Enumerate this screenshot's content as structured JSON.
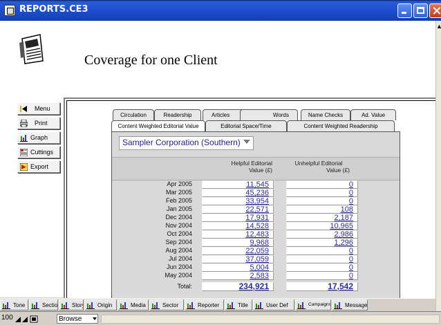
{
  "window": {
    "title": "REPORTS.CE3"
  },
  "page": {
    "title": "Coverage for one Client"
  },
  "nav": {
    "menu": "Menu",
    "print": "Print",
    "graph": "Graph",
    "cuttings": "Cuttings",
    "export": "Export"
  },
  "tabs": {
    "row1": [
      "Circulation",
      "Readership",
      "Articles",
      "Words",
      "Name Checks",
      "Ad. Value"
    ],
    "row2": [
      "Content Weighted Editorial Value",
      "Editorial Space/Time",
      "Content Weighted Readership"
    ]
  },
  "client_select": {
    "value": "Sampler Corporation (Southern)"
  },
  "columns": {
    "helpful_line1": "Helpful Editorial",
    "helpful_line2": "Value (£)",
    "unhelpful_line1": "Unhelpful Editorial",
    "unhelpful_line2": "Value (£)"
  },
  "rows": [
    {
      "month": "Apr 2005",
      "helpful": "11,545",
      "unhelpful": "0"
    },
    {
      "month": "Mar 2005",
      "helpful": "45,236",
      "unhelpful": "0"
    },
    {
      "month": "Feb 2005",
      "helpful": "33,954",
      "unhelpful": "0"
    },
    {
      "month": "Jan 2005",
      "helpful": "22,571",
      "unhelpful": "108"
    },
    {
      "month": "Dec 2004",
      "helpful": "17,931",
      "unhelpful": "2,187"
    },
    {
      "month": "Nov 2004",
      "helpful": "14,528",
      "unhelpful": "10,965"
    },
    {
      "month": "Oct 2004",
      "helpful": "12,483",
      "unhelpful": "2,986"
    },
    {
      "month": "Sep 2004",
      "helpful": "9,968",
      "unhelpful": "1,296"
    },
    {
      "month": "Aug 2004",
      "helpful": "22,059",
      "unhelpful": "0"
    },
    {
      "month": "Jul 2004",
      "helpful": "37,059",
      "unhelpful": "0"
    },
    {
      "month": "Jun 2004",
      "helpful": "5,004",
      "unhelpful": "0"
    },
    {
      "month": "May 2004",
      "helpful": "2,583",
      "unhelpful": "0"
    }
  ],
  "total": {
    "label": "Total:",
    "helpful": "234,921",
    "unhelpful": "17,542"
  },
  "bottom_tabs": [
    "Tone",
    "Section",
    "Story",
    "Origin",
    "Media",
    "Sector",
    "Reporter",
    "Title",
    "User Def",
    "Campaigns",
    "Messages"
  ],
  "status": {
    "zoom": "100",
    "mode": "Browse"
  },
  "colors": {
    "accent_link": "#2a2a9e",
    "titlebar": "#1d4fd1",
    "content_bg": "#d9d9d9"
  }
}
